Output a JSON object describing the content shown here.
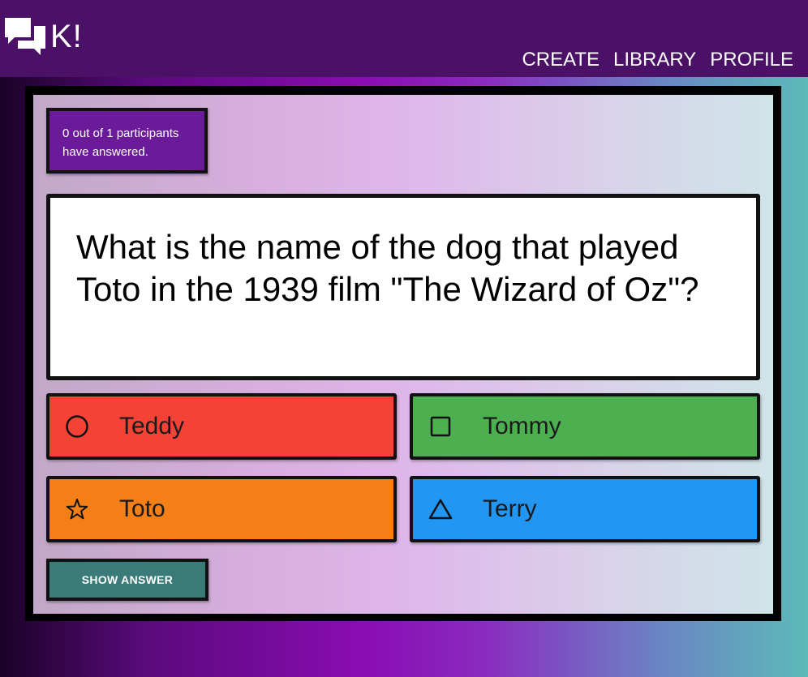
{
  "header": {
    "logo_text": "K!",
    "logo_icon": "chat-bubbles-icon",
    "nav": [
      "CREATE",
      "LIBRARY",
      "PROFILE"
    ],
    "background": "#4a1166"
  },
  "status": {
    "participants_text": "0 out of 1 participants have answered."
  },
  "question": {
    "text": "What is the name of the dog that played Toto in the 1939 film \"The Wizard of Oz\"?"
  },
  "answers": [
    {
      "label": "Teddy",
      "icon": "circle-icon",
      "color": "#f44336"
    },
    {
      "label": "Tommy",
      "icon": "square-icon",
      "color": "#4caf50"
    },
    {
      "label": "Toto",
      "icon": "star-icon",
      "color": "#f57f17"
    },
    {
      "label": "Terry",
      "icon": "triangle-icon",
      "color": "#2196f3"
    }
  ],
  "actions": {
    "show_answer_label": "Show Answer"
  }
}
